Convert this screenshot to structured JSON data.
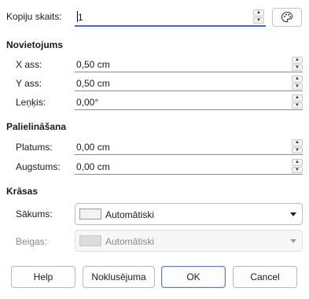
{
  "copies": {
    "label": "Kopiju skaits:",
    "value": "1"
  },
  "placement": {
    "title": "Novietojums",
    "x_label": "X ass:",
    "x_value": "0,50 cm",
    "y_label": "Y ass:",
    "y_value": "0,50 cm",
    "angle_label": "Leņķis:",
    "angle_value": "0,00°"
  },
  "enlargement": {
    "title": "Palielināšana",
    "width_label": "Platums:",
    "width_value": "0,00 cm",
    "height_label": "Augstums:",
    "height_value": "0,00 cm"
  },
  "colors": {
    "title": "Krāsas",
    "start_label": "Sākums:",
    "start_value": "Automātiski",
    "end_label": "Beigas:",
    "end_value": "Automātiski"
  },
  "buttons": {
    "help": "Help",
    "reset": "Noklusējuma",
    "ok": "OK",
    "cancel": "Cancel"
  },
  "icons": {
    "color_button": "palette-icon",
    "spin_up": "chevron-up-icon",
    "spin_down": "chevron-down-icon"
  }
}
